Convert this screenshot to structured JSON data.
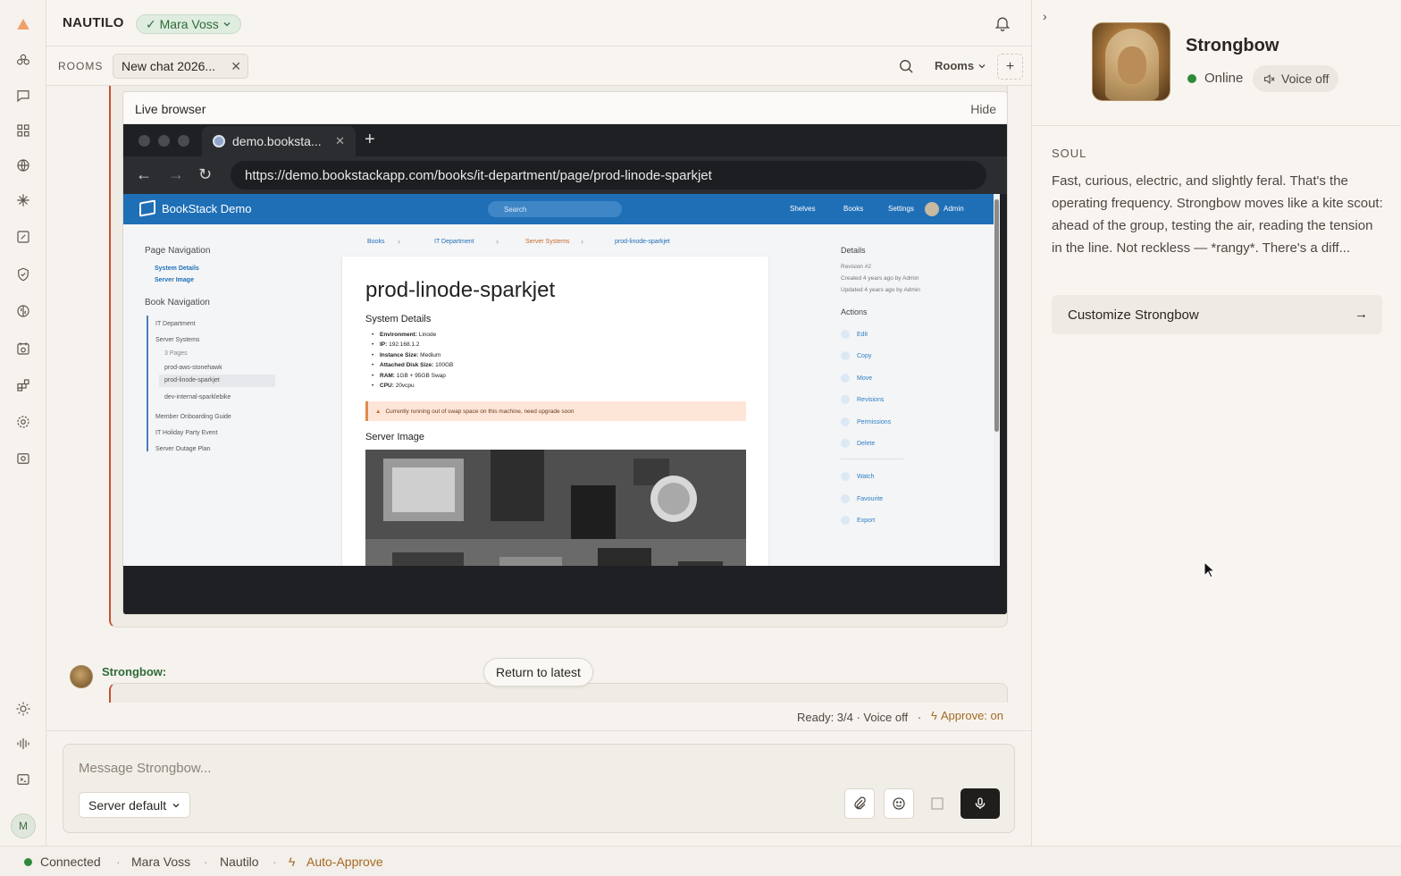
{
  "app": {
    "brand": "NAUTILO",
    "user_chip": "✓ Mara Voss"
  },
  "rooms_bar": {
    "label": "ROOMS",
    "active_tab": "New chat 2026...",
    "rooms_dropdown": "Rooms",
    "add": "+"
  },
  "live_browser": {
    "title": "Live browser",
    "hide_label": "Hide",
    "tab_title": "demo.booksta...",
    "url": "https://demo.bookstackapp.com/books/it-department/page/prod-linode-sparkjet"
  },
  "bookstack": {
    "brand": "BookStack Demo",
    "search_placeholder": "Search",
    "nav": [
      "Shelves",
      "Books",
      "Settings",
      "Admin"
    ],
    "breadcrumbs": [
      "Books",
      "IT Department",
      "Server Systems",
      "prod-linode-sparkjet"
    ],
    "page_nav_title": "Page Navigation",
    "page_nav": [
      "System Details",
      "Server Image"
    ],
    "book_nav_title": "Book Navigation",
    "book_nav": [
      "IT Department",
      "Server Systems",
      "3 Pages",
      "prod-aws-stonehawk",
      "prod-linode-sparkjet",
      "dev-internal-sparklebike",
      "Member Onboarding Guide",
      "IT Holiday Party Event",
      "Server Outage Plan"
    ],
    "page_title": "prod-linode-sparkjet",
    "section1": "System Details",
    "details": [
      {
        "k": "Environment:",
        "v": "Linode"
      },
      {
        "k": "IP:",
        "v": "192.168.1.2"
      },
      {
        "k": "Instance Size:",
        "v": "Medium"
      },
      {
        "k": "Attached Disk Size:",
        "v": "100GB"
      },
      {
        "k": "RAM:",
        "v": "1GB + 95GB Swap"
      },
      {
        "k": "CPU:",
        "v": "20vcpu"
      }
    ],
    "warning": "Currently running out of swap space on this machine, need upgrade soon",
    "section2": "Server Image",
    "details_title": "Details",
    "meta": [
      "Revision #2",
      "Created 4 years ago by Admin",
      "Updated 4 years ago by Admin"
    ],
    "actions_title": "Actions",
    "actions": [
      "Edit",
      "Copy",
      "Move",
      "Revisions",
      "Permissions",
      "Delete"
    ],
    "actions2": [
      "Watch",
      "Favourite",
      "Export"
    ]
  },
  "conversation": {
    "sender": "Strongbow:",
    "return_latest": "Return to latest"
  },
  "status_line": {
    "ready": "Ready: 3/4 · Voice off",
    "sep": "·",
    "approve": "Approve: on"
  },
  "composer": {
    "placeholder": "Message Strongbow...",
    "model": "Server default"
  },
  "agent": {
    "name": "Strongbow",
    "status": "Online",
    "voice": "Voice off",
    "soul_label": "SOUL",
    "soul_text": "Fast, curious, electric, and slightly feral. That's the operating frequency. Strongbow moves like a kite scout: ahead of the group, testing the air, reading the tension in the line. Not reckless — *rangy*. There's a diff...",
    "customize": "Customize Strongbow"
  },
  "footer": {
    "connected": "Connected",
    "user": "Mara Voss",
    "app": "Nautilo",
    "auto_approve": "Auto-Approve",
    "sep": "·"
  },
  "rail": {
    "avatar_initial": "M"
  },
  "colors": {
    "accent_green": "#2f6b37",
    "tool_border": "#c2532e",
    "approve": "#a46a23",
    "bookstack_blue": "#1f6fb7"
  }
}
